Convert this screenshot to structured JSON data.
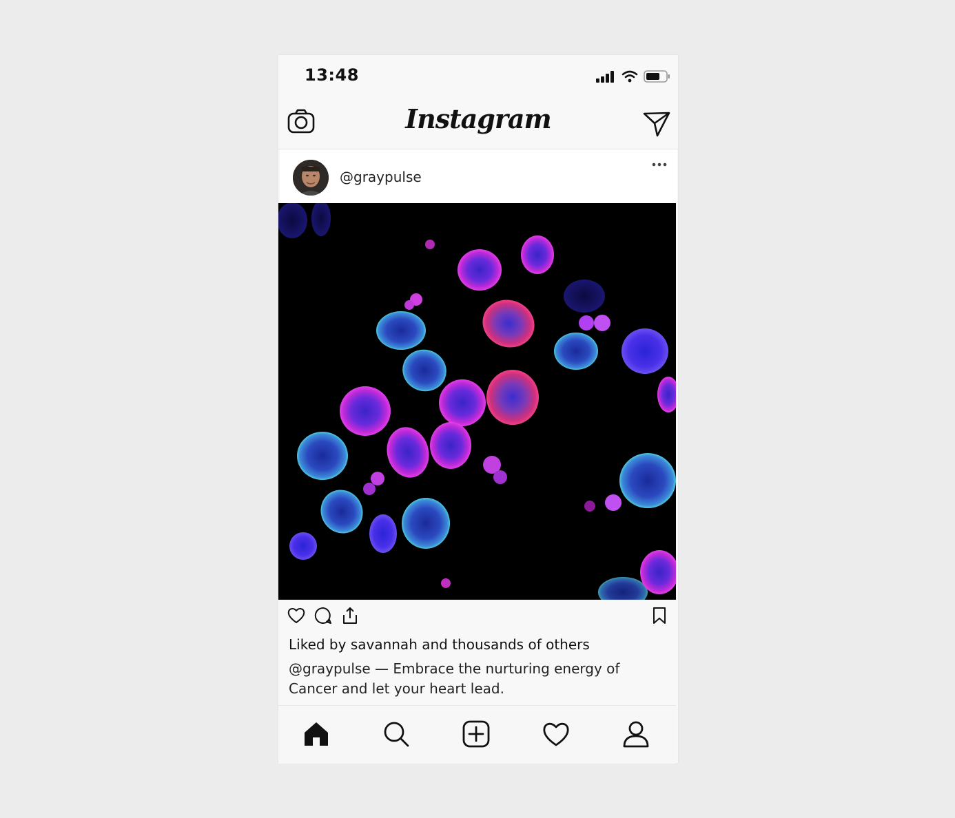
{
  "status": {
    "time": "13:48"
  },
  "header": {
    "brand": "Instagram",
    "camera_icon": "camera-icon",
    "send_icon": "paper-plane-icon"
  },
  "post": {
    "username": "@graypulse",
    "more_icon": "ellipsis-icon",
    "image_subject": "fluorescent-cells-micrograph",
    "likes_text": "Liked by savannah and thousands of others",
    "caption_user": "@graypulse",
    "caption_text": " — Embrace the nurturing energy of Cancer and let your heart lead."
  },
  "actions": [
    "heart-icon",
    "comment-icon",
    "share-icon",
    "bookmark-icon"
  ],
  "nav": [
    "home-icon",
    "search-icon",
    "add-post-icon",
    "activity-heart-icon",
    "profile-icon"
  ],
  "colors": {
    "text": "#111111",
    "background": "#f8f8f8",
    "image_bg": "#000000"
  }
}
